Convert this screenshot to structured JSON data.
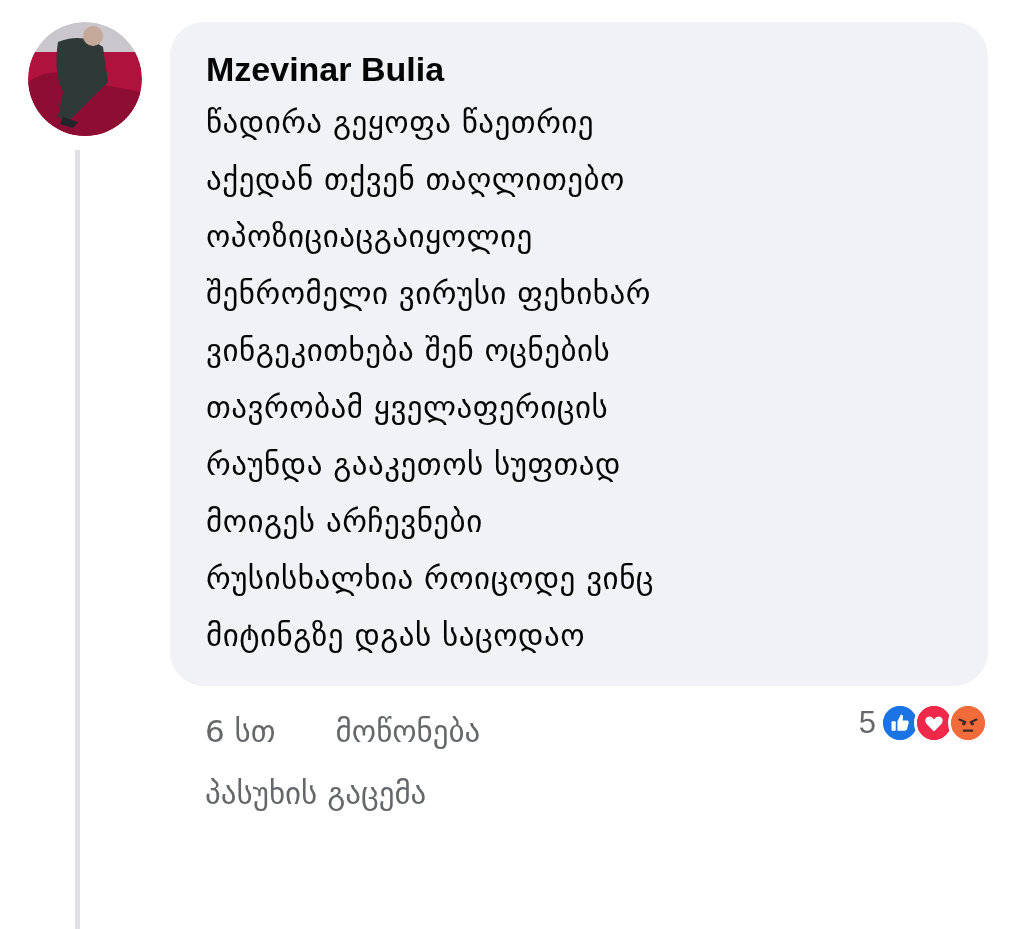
{
  "comment": {
    "author": "Mzevinar Bulia",
    "lines": [
      "წადირა გეყოფა წაეთრიე",
      "აქედან თქვენ თაღლითებო",
      "ოპოზიციაცგაიყოლიე",
      "შენრომელი ვირუსი ფეხიხარ",
      "ვინგეკითხება შენ ოცნების",
      "თავრობამ ყველაფერიცის",
      "რაუნდა გააკეთოს სუფთად",
      "მოიგეს არჩევნები",
      "რუსისხალხია როიცოდე ვინც",
      "მიტინგზე დგას საცოდაო"
    ],
    "time": "6 სთ",
    "like_action": "მოწონება",
    "reply_action": "პასუხის გაცემა",
    "reaction_count": "5",
    "reactions": [
      {
        "kind": "like"
      },
      {
        "kind": "love"
      },
      {
        "kind": "angry"
      }
    ]
  }
}
